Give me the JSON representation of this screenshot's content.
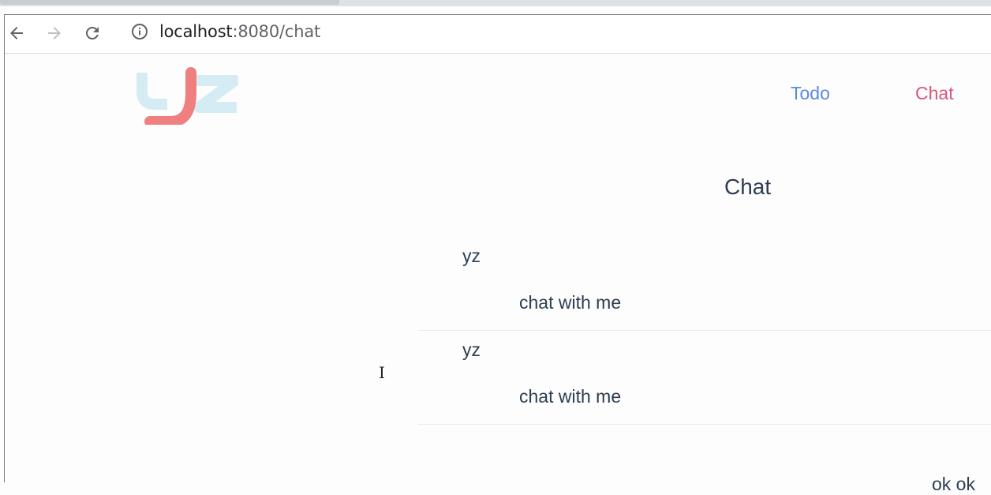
{
  "browser": {
    "url_host": "localhost",
    "url_rest": ":8080/chat"
  },
  "app": {
    "logo_text": "yz",
    "nav": {
      "todo": "Todo",
      "chat": "Chat"
    },
    "title": "Chat",
    "messages": [
      {
        "user": "yz",
        "text": "chat with me"
      },
      {
        "user": "yz",
        "text": "chat with me"
      }
    ],
    "partial_text": "ok ok"
  },
  "colors": {
    "nav_todo": "#5b8be0",
    "nav_chat": "#d9567a",
    "logo_red": "#f08080",
    "logo_blue": "#d6ecf5",
    "text": "#2c3e50"
  }
}
